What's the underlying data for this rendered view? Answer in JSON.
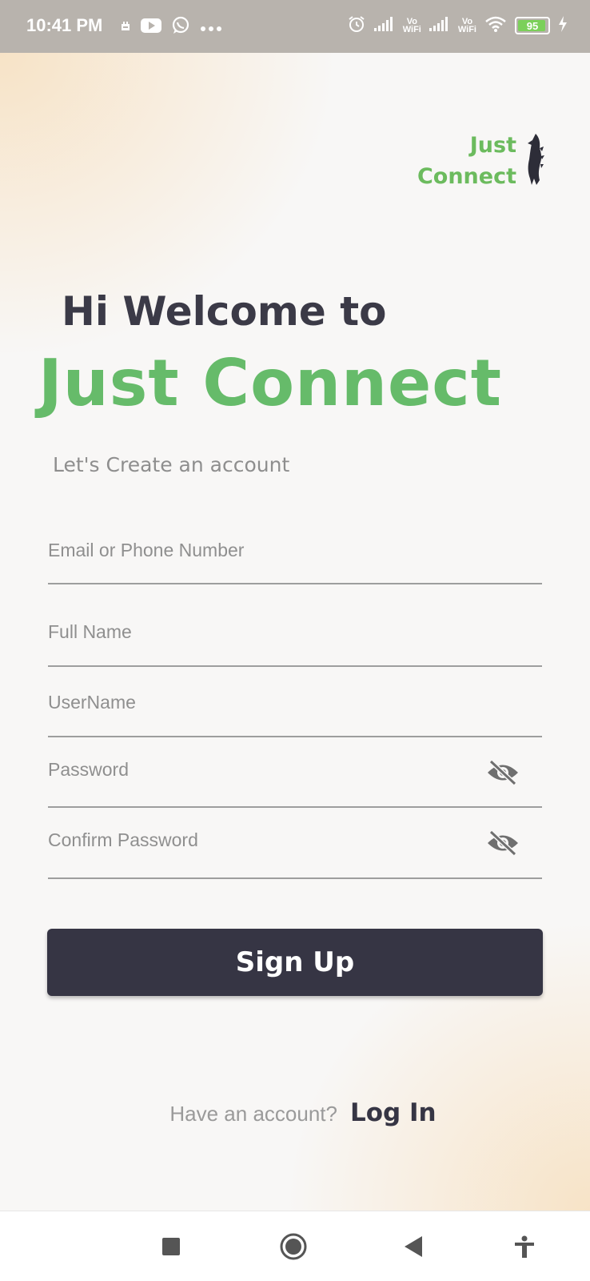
{
  "status_bar": {
    "time": "10:41 PM",
    "sim1_label_top": "Vo",
    "sim1_label_bottom": "WiFi",
    "sim2_label_top": "Vo",
    "sim2_label_bottom": "WiFi",
    "battery_level": "95",
    "battery_fraction": 0.95,
    "icons": [
      "notification-icon",
      "youtube-icon",
      "whatsapp-icon",
      "more-icon",
      "alarm-icon",
      "signal-icon",
      "wifi-icon",
      "battery-icon",
      "charging-icon"
    ]
  },
  "logo": {
    "line1": "Just",
    "line2": "Connect",
    "icon": "dinosaur-icon"
  },
  "hero": {
    "welcome": "Hi Welcome to",
    "app_name": "Just Connect",
    "subtitle": "Let's Create an account"
  },
  "form": {
    "email_placeholder": "Email or Phone Number",
    "fullname_placeholder": "Full Name",
    "username_placeholder": "UserName",
    "password_placeholder": "Password",
    "confirm_password_placeholder": "Confirm Password",
    "visibility_icon": "eye-off-icon",
    "signup_label": "Sign Up"
  },
  "footer": {
    "have_account": "Have an account?",
    "login_label": "Log In"
  },
  "nav_bar": {
    "icons": [
      "recents-icon",
      "home-icon",
      "back-icon",
      "accessibility-icon"
    ]
  },
  "colors": {
    "brand_green": "#66bb6a",
    "dark": "#363544",
    "status_bar": "#b8b3ad",
    "accent_peach": "#f7e2c4"
  }
}
